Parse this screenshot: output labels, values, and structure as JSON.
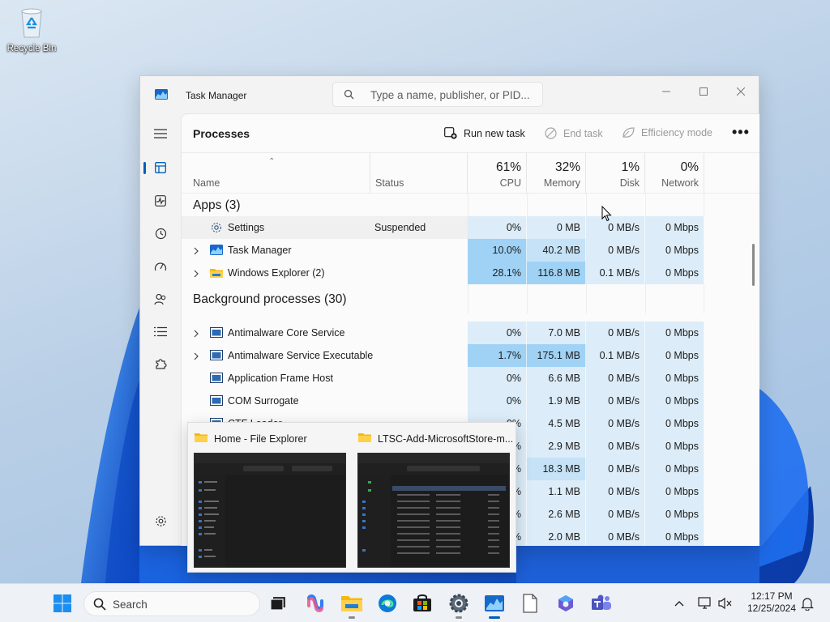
{
  "desktop": {
    "recycle_bin_label": "Recycle Bin"
  },
  "window": {
    "title": "Task Manager",
    "search_placeholder": "Type a name, publisher, or PID..."
  },
  "commandbar": {
    "page_title": "Processes",
    "run_new_task": "Run new task",
    "end_task": "End task",
    "efficiency_mode": "Efficiency mode",
    "more": "•••"
  },
  "columns": {
    "name": "Name",
    "status": "Status",
    "cpu": {
      "pct": "61%",
      "label": "CPU"
    },
    "memory": {
      "pct": "32%",
      "label": "Memory"
    },
    "disk": {
      "pct": "1%",
      "label": "Disk"
    },
    "network": {
      "pct": "0%",
      "label": "Network"
    }
  },
  "sections": {
    "apps": "Apps (3)",
    "background": "Background processes (30)"
  },
  "apps": [
    {
      "name": "Settings",
      "status": "Suspended",
      "cpu": "0%",
      "memory": "0 MB",
      "disk": "0 MB/s",
      "network": "0 Mbps"
    },
    {
      "name": "Task Manager",
      "status": "",
      "cpu": "10.0%",
      "memory": "40.2 MB",
      "disk": "0 MB/s",
      "network": "0 Mbps"
    },
    {
      "name": "Windows Explorer (2)",
      "status": "",
      "cpu": "28.1%",
      "memory": "116.8 MB",
      "disk": "0.1 MB/s",
      "network": "0 Mbps"
    }
  ],
  "background": [
    {
      "name": "Antimalware Core Service",
      "cpu": "0%",
      "memory": "7.0 MB",
      "disk": "0 MB/s",
      "network": "0 Mbps"
    },
    {
      "name": "Antimalware Service Executable",
      "cpu": "1.7%",
      "memory": "175.1 MB",
      "disk": "0.1 MB/s",
      "network": "0 Mbps"
    },
    {
      "name": "Application Frame Host",
      "cpu": "0%",
      "memory": "6.6 MB",
      "disk": "0 MB/s",
      "network": "0 Mbps"
    },
    {
      "name": "COM Surrogate",
      "cpu": "0%",
      "memory": "1.9 MB",
      "disk": "0 MB/s",
      "network": "0 Mbps"
    },
    {
      "name": "CTF Loader",
      "cpu": "0%",
      "memory": "4.5 MB",
      "disk": "0 MB/s",
      "network": "0 Mbps"
    },
    {
      "name": "",
      "cpu": "%",
      "memory": "2.9 MB",
      "disk": "0 MB/s",
      "network": "0 Mbps"
    },
    {
      "name": "",
      "cpu": "%",
      "memory": "18.3 MB",
      "disk": "0 MB/s",
      "network": "0 Mbps"
    },
    {
      "name": "",
      "cpu": "%",
      "memory": "1.1 MB",
      "disk": "0 MB/s",
      "network": "0 Mbps"
    },
    {
      "name": "",
      "cpu": "%",
      "memory": "2.6 MB",
      "disk": "0 MB/s",
      "network": "0 Mbps"
    },
    {
      "name": "",
      "cpu": "%",
      "memory": "2.0 MB",
      "disk": "0 MB/s",
      "network": "0 Mbps"
    }
  ],
  "thumbnails": [
    {
      "title": "Home - File Explorer"
    },
    {
      "title": "LTSC-Add-MicrosoftStore-m..."
    }
  ],
  "taskbar": {
    "search_label": "Search",
    "time": "12:17 PM",
    "date": "12/25/2024"
  },
  "colors": {
    "accent": "#005fb8",
    "heat_low": "#dcecf8",
    "heat_mid": "#c5e2f7",
    "heat_high": "#9fd2f5"
  }
}
